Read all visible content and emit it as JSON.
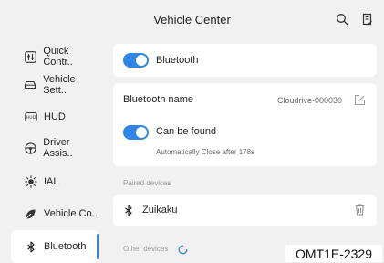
{
  "header": {
    "title": "Vehicle Center",
    "search_icon": "search-icon",
    "notes_icon": "notes-icon"
  },
  "sidebar": {
    "items": [
      {
        "label": "Quick Contr..",
        "icon": "quick-control-icon"
      },
      {
        "label": "Vehicle Sett..",
        "icon": "car-icon"
      },
      {
        "label": "HUD",
        "icon": "hud-icon"
      },
      {
        "label": "Driver Assis..",
        "icon": "steering-wheel-icon"
      },
      {
        "label": "IAL",
        "icon": "light-icon"
      },
      {
        "label": "Vehicle Co..",
        "icon": "leaf-icon"
      },
      {
        "label": "Bluetooth",
        "icon": "bluetooth-icon",
        "active": true
      }
    ]
  },
  "main": {
    "bluetooth_toggle": {
      "label": "Bluetooth",
      "on": true
    },
    "bluetooth_name": {
      "label": "Bluetooth name",
      "value": "Cloudrive-000030"
    },
    "can_be_found": {
      "label": "Can be found",
      "on": true,
      "note": "Automatically Close after 178s"
    },
    "paired_title": "Paired devices",
    "paired_devices": [
      {
        "name": "Zuikaku"
      }
    ],
    "other_title": "Other devices"
  },
  "watermark": "OMT1E-2329",
  "colors": {
    "accent": "#2f86e6",
    "background": "#f1f1f1",
    "card": "#ffffff"
  }
}
